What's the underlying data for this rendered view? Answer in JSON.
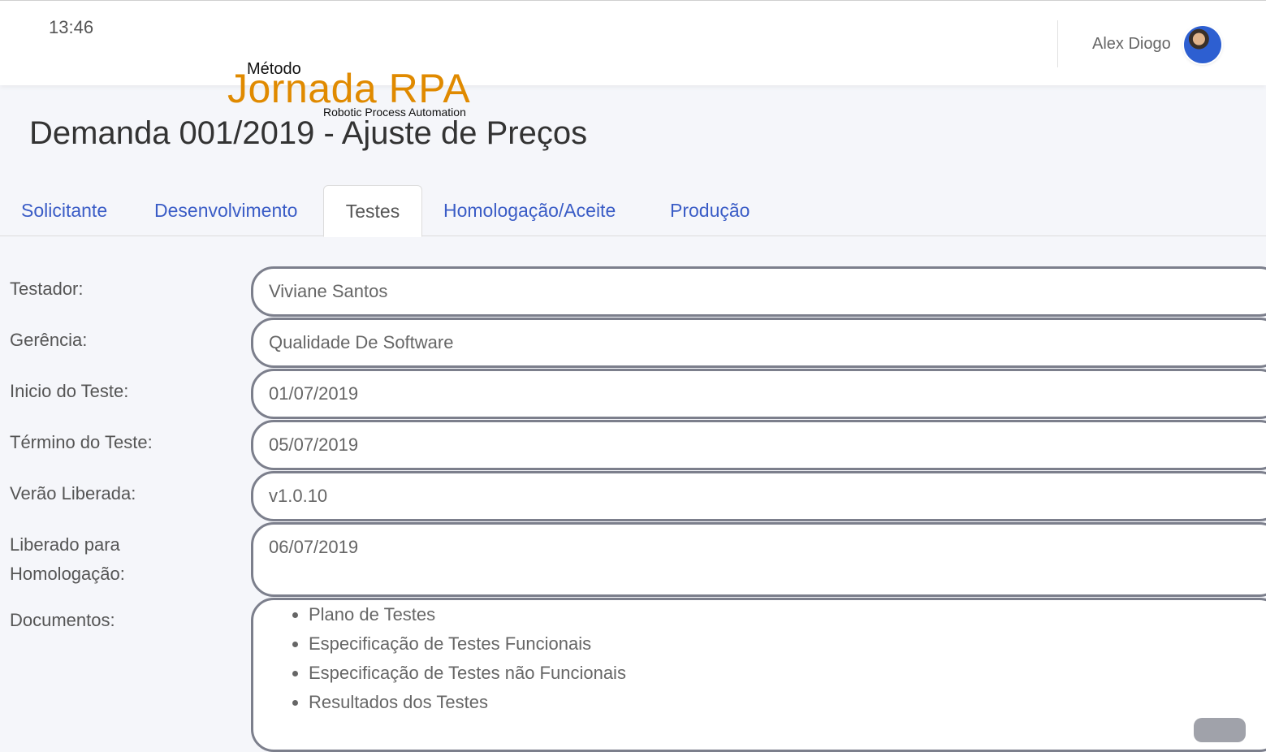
{
  "header": {
    "time": "13:46",
    "user_name": "Alex Diogo",
    "avatar_icon": "user-avatar-photo"
  },
  "logo": {
    "top_text": "Método",
    "main_text": "Jornada RPA",
    "sub_text": "Robotic Process Automation",
    "color": "#e08a00"
  },
  "page": {
    "title": "Demanda 001/2019 - Ajuste de Preços"
  },
  "tabs": [
    {
      "label": "Solicitante",
      "active": false
    },
    {
      "label": "Desenvolvimento",
      "active": false
    },
    {
      "label": "Testes",
      "active": true
    },
    {
      "label": "Homologação/Aceite",
      "active": false
    },
    {
      "label": "Produção",
      "active": false
    }
  ],
  "form": {
    "tester": {
      "label": "Testador:",
      "value": "Viviane Santos"
    },
    "management": {
      "label": "Gerência:",
      "value": "Qualidade De Software"
    },
    "test_start": {
      "label": "Inicio do Teste:",
      "value": "01/07/2019"
    },
    "test_end": {
      "label": "Término do Teste:",
      "value": "05/07/2019"
    },
    "released_version": {
      "label": "Verão Liberada:",
      "value": "v1.0.10"
    },
    "released_homologation": {
      "label_line1": "Liberado para",
      "label_line2": "Homologação:",
      "value": "06/07/2019"
    },
    "documents": {
      "label": "Documentos:",
      "items": [
        "Plano de Testes",
        "Especificação de Testes Funcionais",
        "Especificação de Testes não Funcionais",
        "Resultados dos Testes"
      ]
    }
  },
  "colors": {
    "accent_link": "#3a5cc6",
    "field_border": "#7c7f8c",
    "background": "#f5f6fa"
  }
}
